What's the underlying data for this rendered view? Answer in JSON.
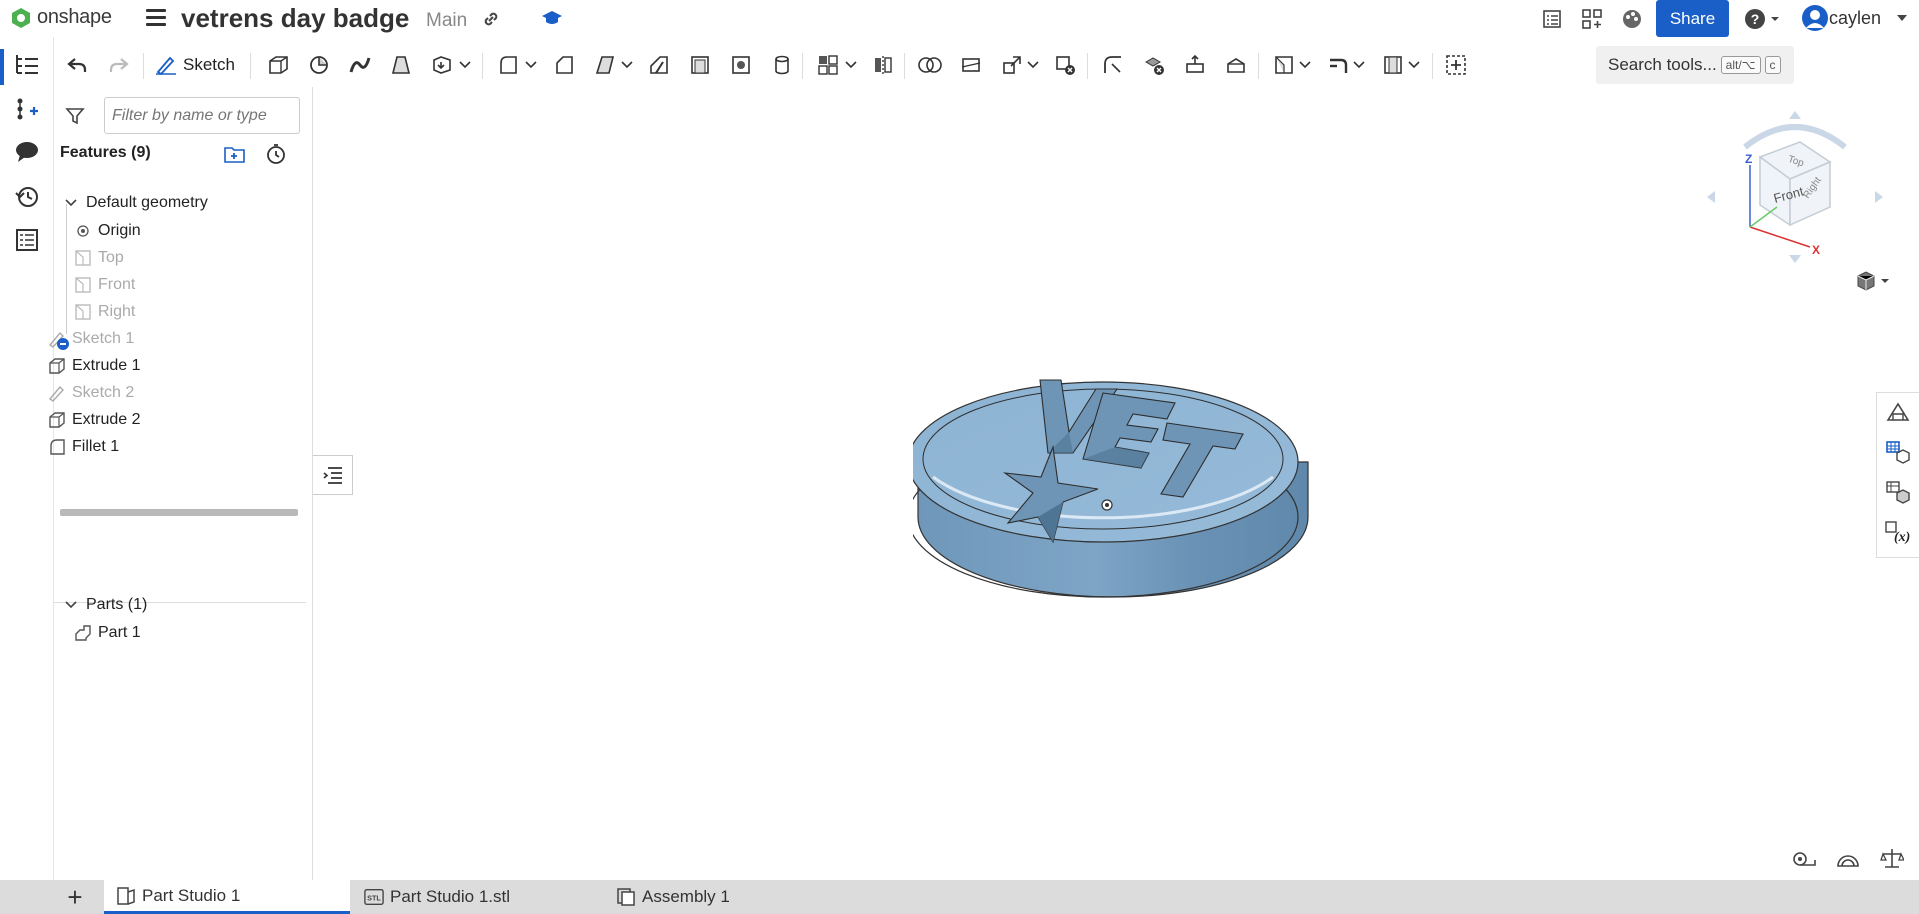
{
  "app": {
    "logo_text": "onshape"
  },
  "document": {
    "title": "vetrens day badge",
    "branch": "Main"
  },
  "header": {
    "share_label": "Share",
    "user_name": "caylen"
  },
  "toolbar": {
    "sketch_label": "Sketch",
    "search_label": "Search tools...",
    "search_shortcut_1": "alt/⌥",
    "search_shortcut_2": "c"
  },
  "feature_panel": {
    "filter_placeholder": "Filter by name or type",
    "features_header": "Features (9)",
    "default_geometry_label": "Default geometry",
    "default_geometry": [
      {
        "label": "Origin",
        "icon": "origin-icon",
        "muted": false
      },
      {
        "label": "Top",
        "icon": "plane-icon",
        "muted": true
      },
      {
        "label": "Front",
        "icon": "plane-icon",
        "muted": true
      },
      {
        "label": "Right",
        "icon": "plane-icon",
        "muted": true
      }
    ],
    "features": [
      {
        "label": "Sketch 1",
        "icon": "sketch-icon",
        "muted": true
      },
      {
        "label": "Extrude 1",
        "icon": "extrude-icon",
        "muted": false
      },
      {
        "label": "Sketch 2",
        "icon": "sketch-icon",
        "muted": true
      },
      {
        "label": "Extrude 2",
        "icon": "extrude-icon",
        "muted": false
      },
      {
        "label": "Fillet 1",
        "icon": "fillet-icon",
        "muted": false
      }
    ],
    "parts_header": "Parts (1)",
    "parts": [
      {
        "label": "Part 1",
        "icon": "part-icon"
      }
    ]
  },
  "viewcube": {
    "top": "Top",
    "front": "Front",
    "right": "Right",
    "axis_x": "X",
    "axis_z": "Z"
  },
  "model": {
    "engraved_text": "VET"
  },
  "tabs": [
    {
      "label": "Part Studio 1",
      "icon": "part-studio-icon",
      "active": true
    },
    {
      "label": "Part Studio 1.stl",
      "icon": "stl-icon",
      "active": false
    },
    {
      "label": "Assembly 1",
      "icon": "assembly-icon",
      "active": false
    }
  ],
  "colors": {
    "accent": "#1a5fc7",
    "model": "#8fb4d4",
    "model_dark": "#5e88ab"
  }
}
